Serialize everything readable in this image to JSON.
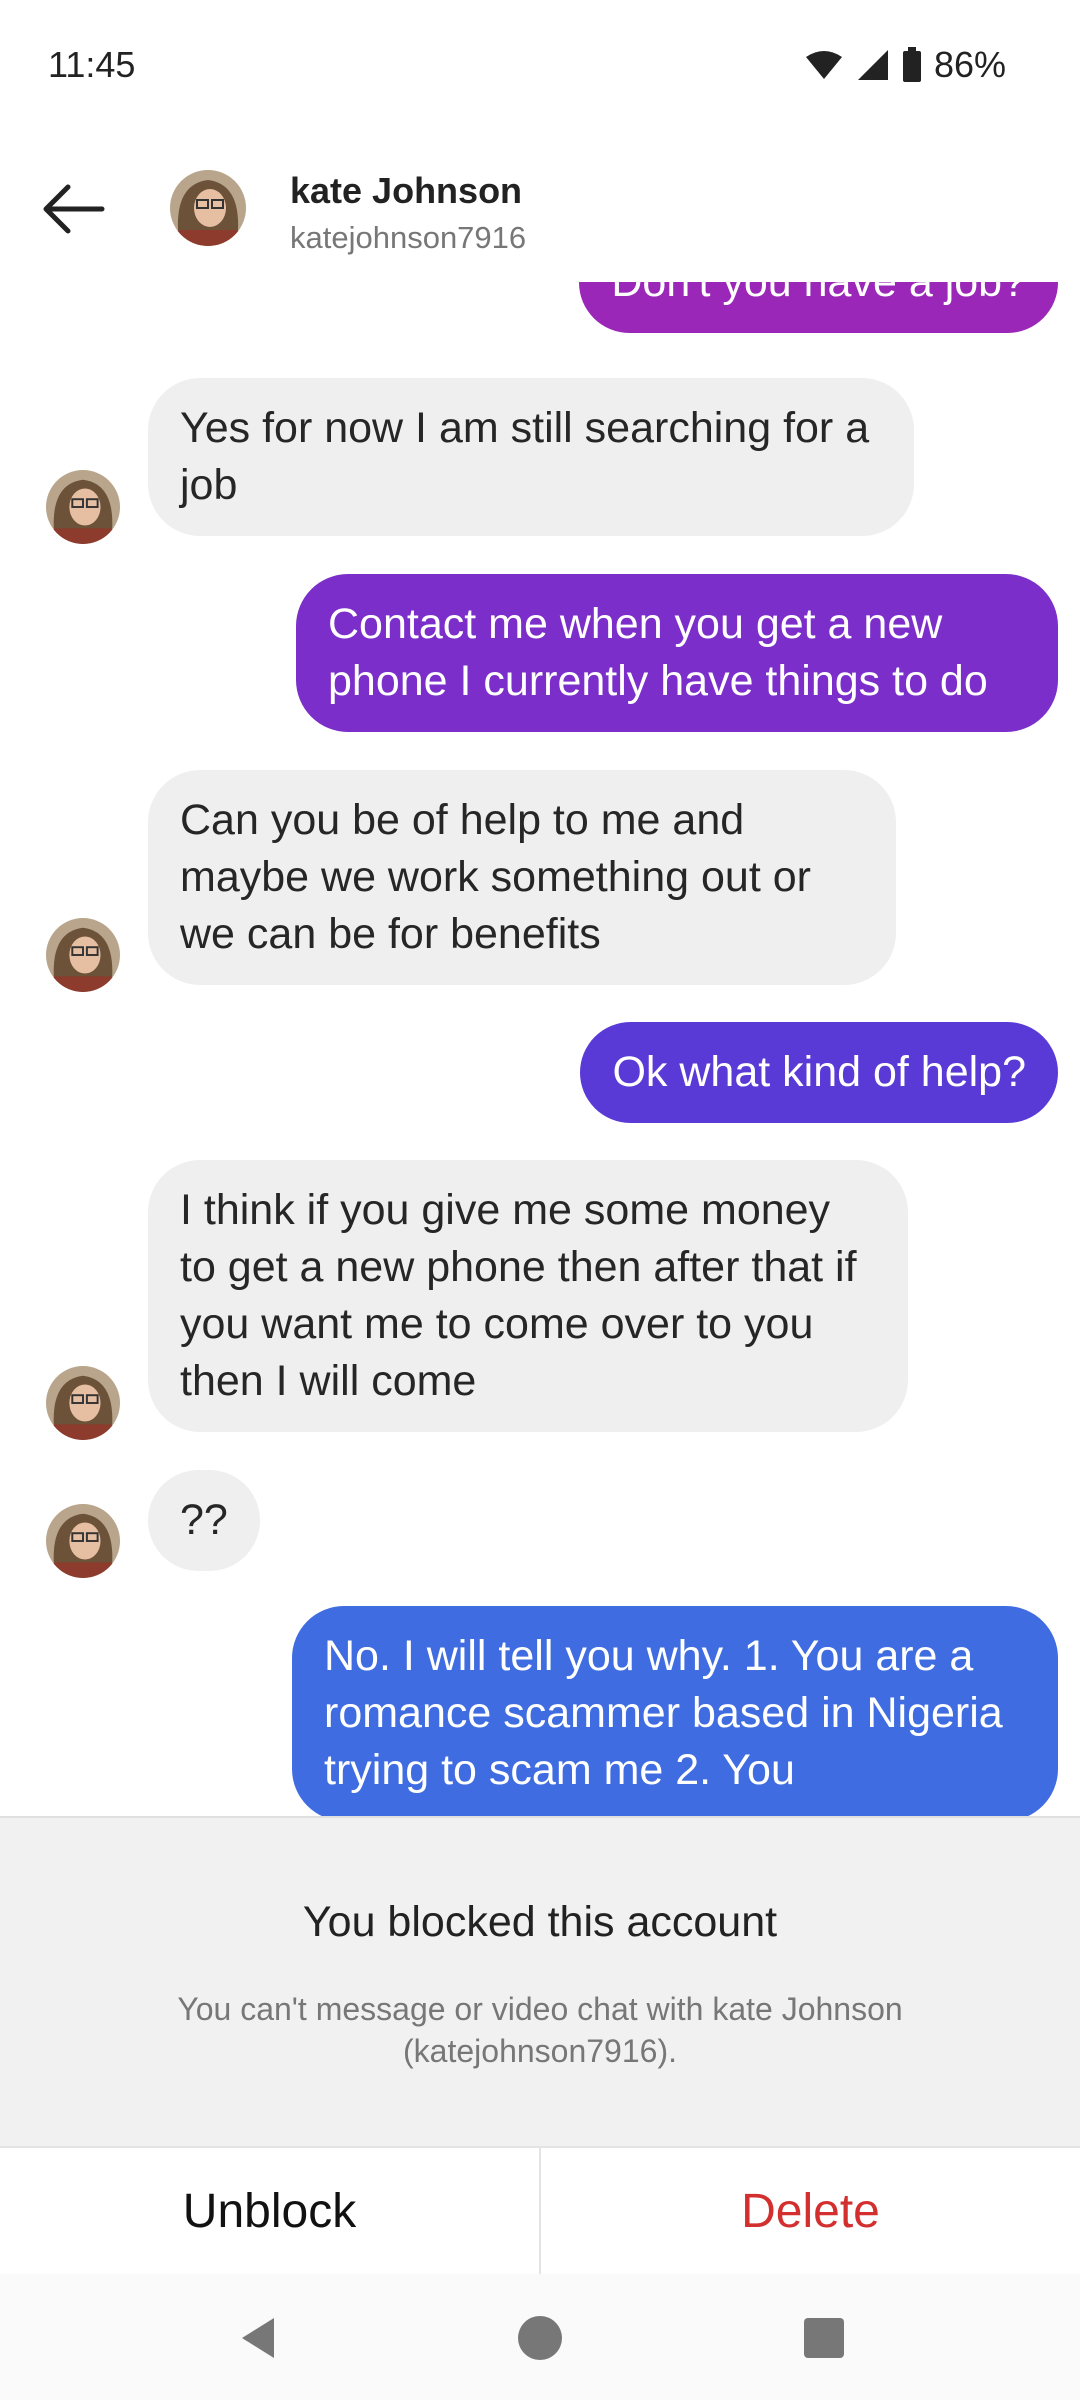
{
  "status": {
    "time": "11:45",
    "battery": "86%"
  },
  "header": {
    "name": "kate Johnson",
    "username": "katejohnson7916"
  },
  "messages": {
    "m0": "Don't you have a job?",
    "m1": "Yes for now I am still searching for a job",
    "m2": "Contact me when you get a new phone I currently have things to do",
    "m3": "Can you be of help to me and maybe we work something out or we can be for benefits",
    "m4": "Ok what kind of help?",
    "m5": "I think if you give me some money to get a new phone then after that if you want me to come over to you then I will come",
    "m6": "??",
    "m7": "No. I will tell you why. 1.  You are a romance scammer based in Nigeria trying to scam me 2. You"
  },
  "blocked": {
    "title": "You blocked this account",
    "subtitle": "You can't message or video chat with kate Johnson (katejohnson7916)."
  },
  "actions": {
    "unblock": "Unblock",
    "delete": "Delete"
  },
  "colors": {
    "sent_top": "#9b27b8",
    "sent_mid": "#6a35d6",
    "sent_bottom": "#3f6ce0",
    "delete": "#d32f2f"
  },
  "icons": [
    "wifi-icon",
    "signal-icon",
    "battery-icon",
    "back-arrow-icon",
    "nav-back-icon",
    "nav-home-icon",
    "nav-recents-icon"
  ]
}
